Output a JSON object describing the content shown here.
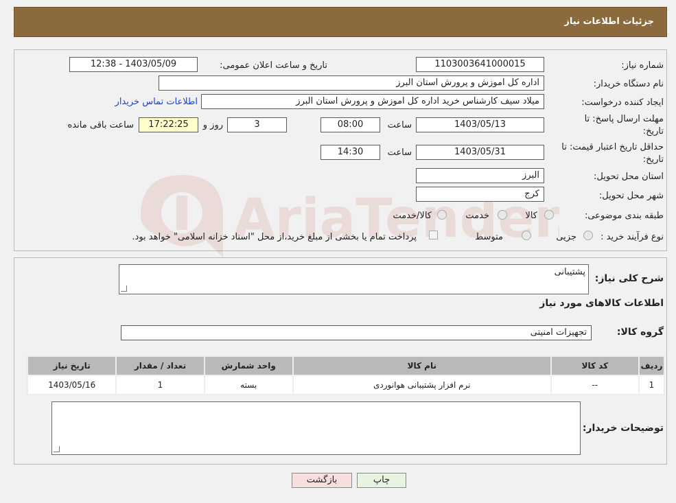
{
  "header": {
    "title": "جزئیات اطلاعات نیاز"
  },
  "form": {
    "need_number": {
      "label": "شماره نیاز:",
      "value": "1103003641000015"
    },
    "announce_datetime": {
      "label": "تاریخ و ساعت اعلان عمومی:",
      "value": "1403/05/09 - 12:38"
    },
    "buyer_org": {
      "label": "نام دستگاه خریدار:",
      "value": "اداره کل اموزش و پرورش استان البرز"
    },
    "requester": {
      "label": "ایجاد کننده درخواست:",
      "value": "میلاد  سیف  کارشناس خرید  اداره کل اموزش و پرورش استان البرز",
      "contact_link": "اطلاعات تماس خریدار"
    },
    "deadline": {
      "label_line1": "مهلت ارسال پاسخ: تا",
      "label_line2": "تاریخ:",
      "date": "1403/05/13",
      "time_label": "ساعت",
      "time": "08:00",
      "days": "3",
      "days_label": "روز و",
      "remaining": "17:22:25",
      "remaining_label": "ساعت باقی مانده"
    },
    "price_validity": {
      "label_line1": "حداقل تاریخ اعتبار قیمت: تا",
      "label_line2": "تاریخ:",
      "date": "1403/05/31",
      "time_label": "ساعت",
      "time": "14:30"
    },
    "province": {
      "label": "استان محل تحویل:",
      "value": "البرز"
    },
    "city": {
      "label": "شهر محل تحویل:",
      "value": "کرج"
    },
    "category": {
      "label": "طبقه بندی موضوعی:",
      "options": [
        "کالا",
        "خدمت",
        "کالا/خدمت"
      ]
    },
    "process_type": {
      "label": "نوع فرآیند خرید :",
      "options": [
        "جزیی",
        "متوسط"
      ],
      "note": "پرداخت تمام یا بخشی از مبلغ خرید،از محل \"اسناد خزانه اسلامی\" خواهد بود."
    }
  },
  "details": {
    "general_desc_label": "شرح کلی نیاز:",
    "general_desc_value": "پشتیبانی",
    "items_title": "اطلاعات کالاهای مورد نیاز",
    "goods_group_label": "گروه کالا:",
    "goods_group_value": "تجهیزات امنیتی",
    "table": {
      "headers": [
        "ردیف",
        "کد کالا",
        "نام کالا",
        "واحد شمارش",
        "تعداد / مقدار",
        "تاریخ نیاز"
      ],
      "rows": [
        [
          "1",
          "--",
          "نرم افزار پشتیبانی هوانوردی",
          "بسته",
          "1",
          "1403/05/16"
        ]
      ]
    },
    "buyer_notes_label": "توضیحات خریدار:"
  },
  "buttons": {
    "print": "چاپ",
    "back": "بازگشت"
  },
  "colors": {
    "header_bg": "#8b6b3d",
    "back_button_bg": "#f9dede",
    "print_button_bg": "#e6f5e0",
    "remaining_bg": "#ffffcc",
    "link": "#1a3fd6"
  }
}
